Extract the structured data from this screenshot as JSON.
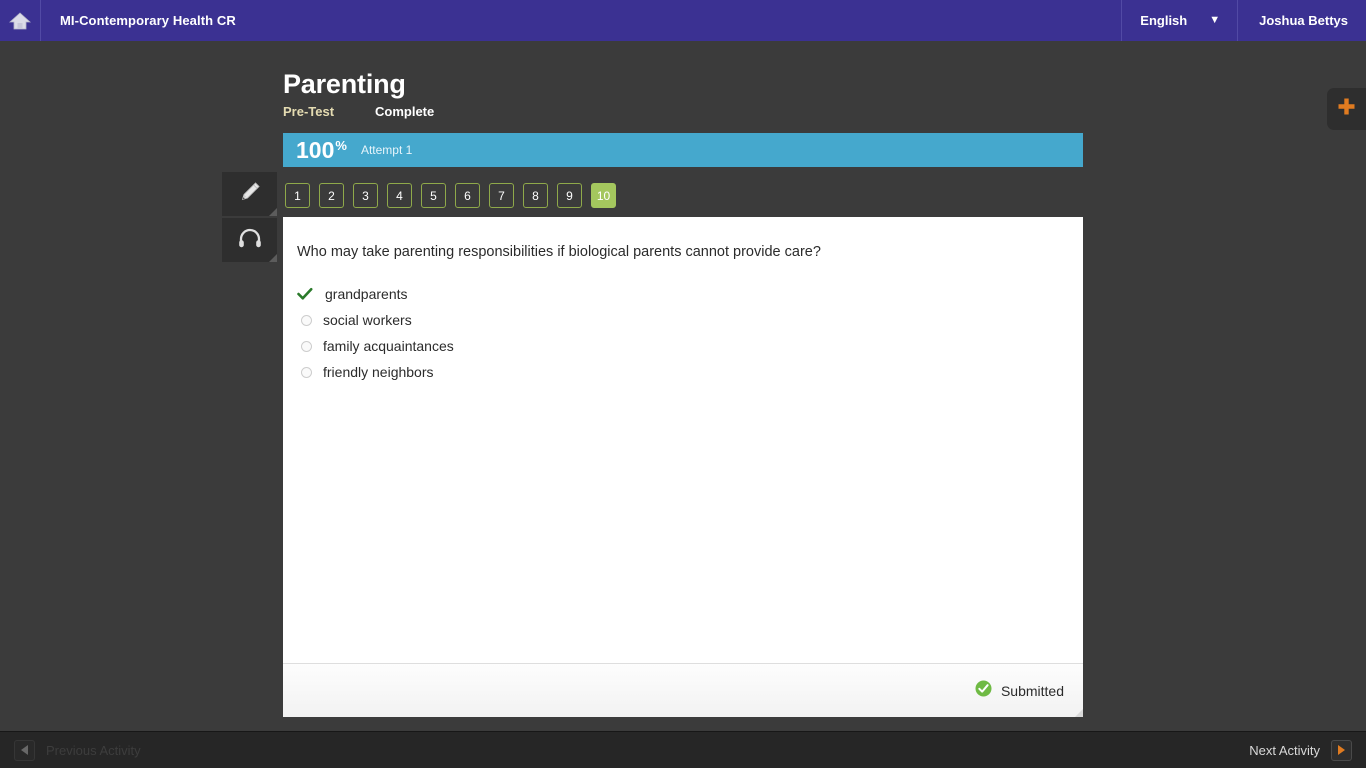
{
  "header": {
    "home_icon": "home-icon",
    "course_title": "MI-Contemporary Health CR",
    "language": "English",
    "language_chevron": "chevron-down-icon",
    "user_name": "Joshua Bettys"
  },
  "add_panel": {
    "icon": "plus-icon"
  },
  "activity": {
    "title": "Parenting",
    "type": "Pre-Test",
    "status": "Complete"
  },
  "score": {
    "value": "100",
    "percent_symbol": "%",
    "attempt": "Attempt 1",
    "bar_color": "#45a8cd"
  },
  "tools": [
    {
      "name": "highlighter-tool",
      "icon": "pencil-icon"
    },
    {
      "name": "audio-tool",
      "icon": "headphones-icon"
    }
  ],
  "question_nav": {
    "items": [
      "1",
      "2",
      "3",
      "4",
      "5",
      "6",
      "7",
      "8",
      "9",
      "10"
    ],
    "active_index": 9,
    "active_color": "#a4c75e",
    "border_color": "#8fa94a"
  },
  "question": {
    "text": "Who may take parenting responsibilities if biological parents cannot provide care?",
    "options": [
      {
        "label": "grandparents",
        "selected": true
      },
      {
        "label": "social workers",
        "selected": false
      },
      {
        "label": "family acquaintances",
        "selected": false
      },
      {
        "label": "friendly neighbors",
        "selected": false
      }
    ]
  },
  "card_footer": {
    "status_icon": "check-circle-icon",
    "status_label": "Submitted",
    "status_color": "#6fba44"
  },
  "bottom_nav": {
    "previous_label": "Previous Activity",
    "previous_enabled": false,
    "previous_icon": "triangle-left-icon",
    "next_label": "Next Activity",
    "next_enabled": true,
    "next_icon": "triangle-right-icon",
    "next_color": "#e07b20"
  }
}
